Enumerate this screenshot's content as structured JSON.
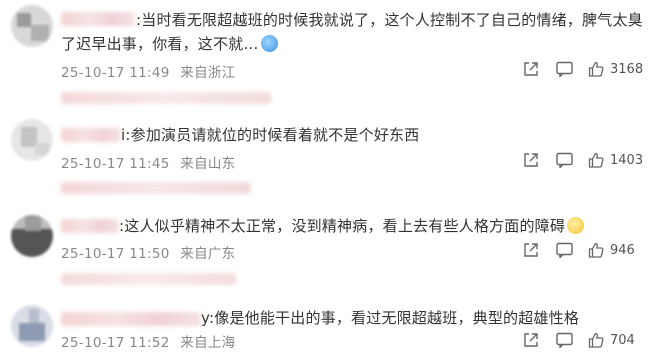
{
  "comments": [
    {
      "text": ":当时看无限超越班的时候我就说了，这个人控制不了自己的情绪，脾气太臭了迟早出事，你看，这不就…",
      "time": "25-10-17 11:49",
      "location": "来自浙江",
      "likes": "3168",
      "emoji": "sweat-emoji"
    },
    {
      "text": "i:参加演员请就位的时候看着就不是个好东西",
      "time": "25-10-17 11:45",
      "location": "来自山东",
      "likes": "1403"
    },
    {
      "text": ":这人似乎精神不太正常，没到精神病，看上去有些人格方面的障碍",
      "time": "25-10-17 11:50",
      "location": "来自广东",
      "likes": "946",
      "emoji": "thinking-emoji"
    },
    {
      "text": "y:像是他能干出的事，看过无限超越班，典型的超雄性格",
      "time": "25-10-17 11:52",
      "location": "来自上海",
      "likes": "704"
    }
  ],
  "icons": {
    "share": "share-icon",
    "comment": "comment-icon",
    "like": "thumbs-up-icon"
  },
  "colors": {
    "text": "#333333",
    "meta": "#888888",
    "blurred_name": "#f3d3d3"
  }
}
